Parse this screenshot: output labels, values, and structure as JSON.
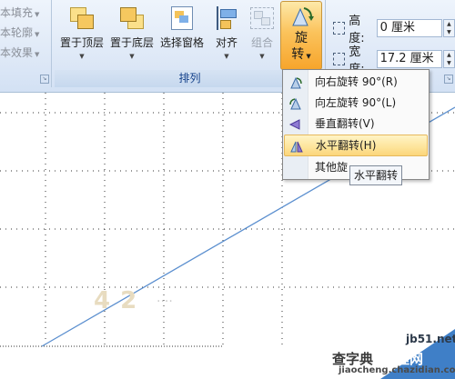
{
  "ribbon": {
    "left_group": {
      "items": [
        "本填充",
        "本轮廓",
        "本效果"
      ]
    },
    "arrange": {
      "label": "排列",
      "buttons": {
        "bring_front": "置于顶层",
        "send_back": "置于底层",
        "selection_pane": "选择窗格",
        "align": "对齐",
        "group": "组合",
        "rotate_top": "旋",
        "rotate_bottom": "转"
      }
    },
    "size": {
      "height_label": "高度:",
      "height_value": "0 厘米",
      "width_label": "宽度:",
      "width_value": "17.2 厘米"
    }
  },
  "rotate_menu": {
    "items": [
      {
        "label": "向右旋转 90°(R)",
        "icon": "rotate-right-icon"
      },
      {
        "label": "向左旋转 90°(L)",
        "icon": "rotate-left-icon"
      },
      {
        "label": "垂直翻转(V)",
        "icon": "flip-vertical-icon"
      },
      {
        "label": "水平翻转(H)",
        "icon": "flip-horizontal-icon"
      },
      {
        "label": "其他旋",
        "icon": ""
      }
    ],
    "highlighted_index": 3
  },
  "tooltip": "水平翻转",
  "canvas": {
    "shape_label": "4 2",
    "shape_dots": "...."
  },
  "watermark": {
    "site": "jb51.net",
    "brand1": "查字典",
    "brand2": "教程网",
    "url": "jiaocheng.chazidian.com"
  },
  "colors": {
    "accent_orange": "#f7a52c",
    "ribbon_blue": "#dfe9f7",
    "group_label": "#15428b",
    "line": "#5b8fcf"
  }
}
